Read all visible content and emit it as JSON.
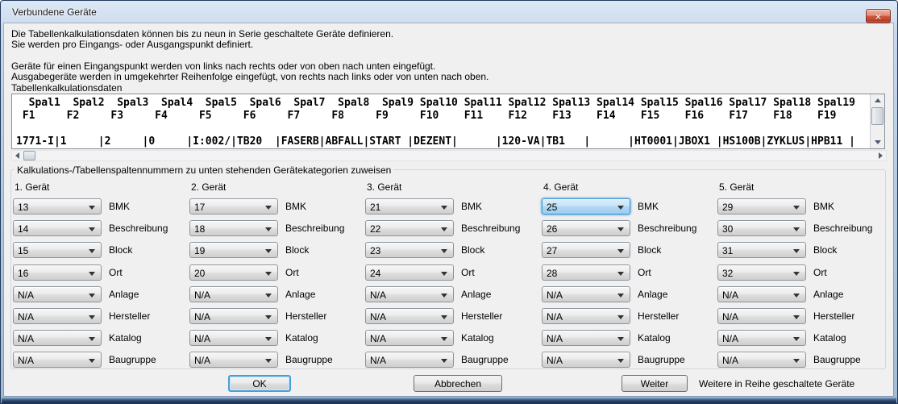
{
  "window": {
    "title": "Verbundene Geräte"
  },
  "icons": {
    "close": "✕",
    "combo_arrow": "css-triangle-down",
    "scroll_up": "css-triangle-up",
    "scroll_down": "css-triangle-down",
    "scroll_left": "css-triangle-left",
    "scroll_right": "css-triangle-right"
  },
  "colors": {
    "focus_blue": "#3a96d2",
    "default_button_ring": "#44a0d9",
    "close_red": "#bb3d24",
    "titlebar_blue": "#b4c8de",
    "content_gray": "#f0f0f0"
  },
  "intro": {
    "line1": "Die Tabellenkalkulationsdaten können bis zu neun in Serie geschaltete Geräte definieren.",
    "line2": "Sie werden pro Eingangs- oder Ausgangspunkt definiert.",
    "line3": "Geräte für einen Eingangspunkt werden von links nach rechts oder von oben nach unten eingefügt.",
    "line4": "Ausgabegeräte werden in umgekehrter Reihenfolge eingefügt, von rechts nach links oder von unten nach oben."
  },
  "spreadsheet": {
    "label": "Tabellenkalkulationsdaten",
    "header_row": "  Spal1  Spal2  Spal3  Spal4  Spal5  Spal6  Spal7  Spal8  Spal9 Spal10 Spal11 Spal12 Spal13 Spal14 Spal15 Spal16 Spal17 Spal18 Spal19",
    "field_row": " F1     F2     F3     F4     F5     F6     F7     F8     F9     F10    F11    F12    F13    F14    F15    F16    F17    F18    F19   ",
    "data_row": "1771-I|1     |2     |0     |I:002/|TB20  |FASERB|ABFALL|START |DEZENT|      |120-VA|TB1   |      |HT0001|JBOX1 |HS100B|ZYKLUS|HPB11 |"
  },
  "assign": {
    "label": "Kalkulations-/Tabellenspaltennummern zu unten stehenden Gerätekategorien zuweisen",
    "row_labels": [
      "BMK",
      "Beschreibung",
      "Block",
      "Ort",
      "Anlage",
      "Hersteller",
      "Katalog",
      "Baugruppe"
    ],
    "devices": [
      {
        "title": "1. Gerät",
        "values": [
          "13",
          "14",
          "15",
          "16",
          "N/A",
          "N/A",
          "N/A",
          "N/A"
        ]
      },
      {
        "title": "2. Gerät",
        "values": [
          "17",
          "18",
          "19",
          "20",
          "N/A",
          "N/A",
          "N/A",
          "N/A"
        ]
      },
      {
        "title": "3. Gerät",
        "values": [
          "21",
          "22",
          "23",
          "24",
          "N/A",
          "N/A",
          "N/A",
          "N/A"
        ]
      },
      {
        "title": "4. Gerät",
        "values": [
          "25",
          "26",
          "27",
          "28",
          "N/A",
          "N/A",
          "N/A",
          "N/A"
        ],
        "focused_index": 0
      },
      {
        "title": "5. Gerät",
        "values": [
          "29",
          "30",
          "31",
          "32",
          "N/A",
          "N/A",
          "N/A",
          "N/A"
        ]
      }
    ]
  },
  "footer": {
    "ok_label": "OK",
    "cancel_label": "Abbrechen",
    "next_label": "Weiter",
    "next_note": "Weitere in Reihe geschaltete Geräte"
  }
}
